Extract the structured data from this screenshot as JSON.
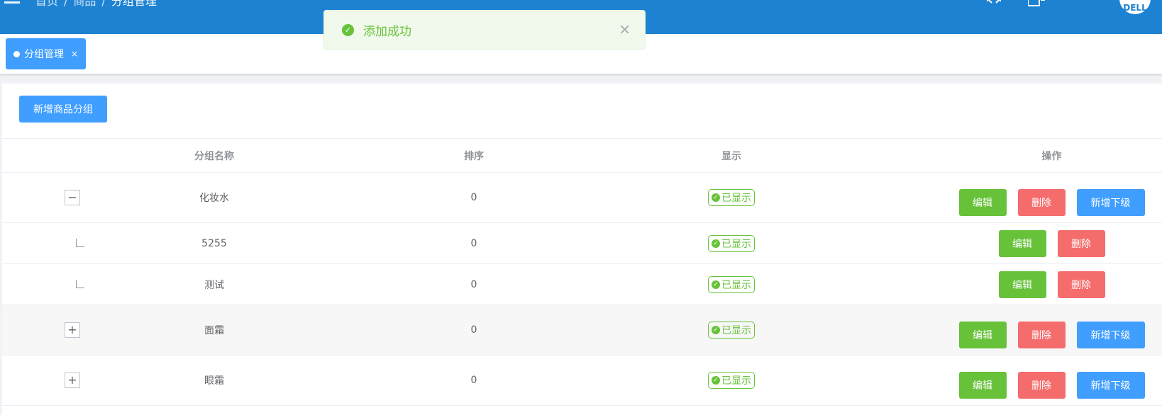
{
  "header": {
    "breadcrumb": [
      "首页",
      "商品",
      "分组管理"
    ],
    "separator": "/",
    "avatar_text": "DELL"
  },
  "tagbar": {
    "tags": [
      {
        "label": "分组管理",
        "close": "×"
      }
    ]
  },
  "toolbar": {
    "add_label": "新增商品分组"
  },
  "table": {
    "headers": [
      "分组名称",
      "排序",
      "显示",
      "操作"
    ],
    "rows": [
      {
        "name": "化妆水",
        "sort": "0",
        "status": "已显示",
        "level": "parent",
        "expanded": true,
        "actions": [
          "编辑",
          "删除",
          "新增下级"
        ]
      },
      {
        "name": "5255",
        "sort": "0",
        "status": "已显示",
        "level": "child",
        "actions": [
          "编辑",
          "删除"
        ]
      },
      {
        "name": "测试",
        "sort": "0",
        "status": "已显示",
        "level": "child",
        "actions": [
          "编辑",
          "删除"
        ]
      },
      {
        "name": "面霜",
        "sort": "0",
        "status": "已显示",
        "level": "parent",
        "expanded": false,
        "actions": [
          "编辑",
          "删除",
          "新增下级"
        ]
      },
      {
        "name": "眼霜",
        "sort": "0",
        "status": "已显示",
        "level": "parent",
        "expanded": false,
        "actions": [
          "编辑",
          "删除",
          "新增下级"
        ]
      }
    ]
  },
  "toast": {
    "message": "添加成功",
    "type": "success"
  },
  "icons": {
    "expand": "+",
    "collapse": "−",
    "check": "✓",
    "close": "×"
  },
  "colors": {
    "header": "#1e82d2",
    "primary": "#409eff",
    "success": "#67c23a",
    "danger": "#f56c6c"
  }
}
